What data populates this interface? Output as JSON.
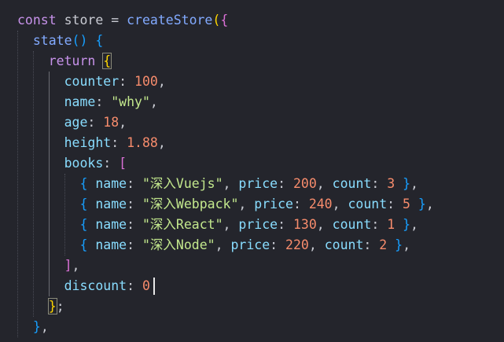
{
  "theme": {
    "background": "#24252c",
    "keyword": "#c792ea",
    "function": "#82aaff",
    "property": "#89ddff",
    "number": "#f78c6c",
    "string": "#c3e88d",
    "punctuation": "#c9cbd3",
    "bracket_outer": "#ffd700",
    "bracket_inner": "#da70d6",
    "bracket_blue": "#179fff"
  },
  "code_lines": [
    [
      {
        "t": "const",
        "c": "keyword"
      },
      {
        "t": " store ",
        "c": "punctuation"
      },
      {
        "t": "=",
        "c": "punctuation"
      },
      {
        "t": " ",
        "c": "punctuation"
      },
      {
        "t": "createStore",
        "c": "function"
      },
      {
        "t": "(",
        "c": "bracket_outer"
      },
      {
        "t": "{",
        "c": "bracket_inner"
      }
    ],
    [
      {
        "t": "  ",
        "c": "punctuation"
      },
      {
        "t": "state",
        "c": "function"
      },
      {
        "t": "()",
        "c": "bracket_blue"
      },
      {
        "t": " ",
        "c": "punctuation"
      },
      {
        "t": "{",
        "c": "bracket_blue"
      }
    ],
    [
      {
        "t": "    ",
        "c": "punctuation"
      },
      {
        "t": "return",
        "c": "keyword"
      },
      {
        "t": " ",
        "c": "punctuation"
      },
      {
        "t": "{",
        "c": "bracket_outer",
        "match": true
      }
    ],
    [
      {
        "t": "      ",
        "c": "punctuation"
      },
      {
        "t": "counter",
        "c": "property"
      },
      {
        "t": ": ",
        "c": "punctuation"
      },
      {
        "t": "100",
        "c": "number"
      },
      {
        "t": ",",
        "c": "punctuation"
      }
    ],
    [
      {
        "t": "      ",
        "c": "punctuation"
      },
      {
        "t": "name",
        "c": "property"
      },
      {
        "t": ": ",
        "c": "punctuation"
      },
      {
        "t": "\"why\"",
        "c": "string"
      },
      {
        "t": ",",
        "c": "punctuation"
      }
    ],
    [
      {
        "t": "      ",
        "c": "punctuation"
      },
      {
        "t": "age",
        "c": "property"
      },
      {
        "t": ": ",
        "c": "punctuation"
      },
      {
        "t": "18",
        "c": "number"
      },
      {
        "t": ",",
        "c": "punctuation"
      }
    ],
    [
      {
        "t": "      ",
        "c": "punctuation"
      },
      {
        "t": "height",
        "c": "property"
      },
      {
        "t": ": ",
        "c": "punctuation"
      },
      {
        "t": "1.88",
        "c": "number"
      },
      {
        "t": ",",
        "c": "punctuation"
      }
    ],
    [
      {
        "t": "      ",
        "c": "punctuation"
      },
      {
        "t": "books",
        "c": "property"
      },
      {
        "t": ": ",
        "c": "punctuation"
      },
      {
        "t": "[",
        "c": "bracket_inner"
      }
    ],
    [
      {
        "t": "        ",
        "c": "punctuation"
      },
      {
        "t": "{",
        "c": "bracket_blue"
      },
      {
        "t": " ",
        "c": "punctuation"
      },
      {
        "t": "name",
        "c": "property"
      },
      {
        "t": ": ",
        "c": "punctuation"
      },
      {
        "t": "\"深入Vuejs\"",
        "c": "string"
      },
      {
        "t": ", ",
        "c": "punctuation"
      },
      {
        "t": "price",
        "c": "property"
      },
      {
        "t": ": ",
        "c": "punctuation"
      },
      {
        "t": "200",
        "c": "number"
      },
      {
        "t": ", ",
        "c": "punctuation"
      },
      {
        "t": "count",
        "c": "property"
      },
      {
        "t": ": ",
        "c": "punctuation"
      },
      {
        "t": "3",
        "c": "number"
      },
      {
        "t": " ",
        "c": "punctuation"
      },
      {
        "t": "}",
        "c": "bracket_blue"
      },
      {
        "t": ",",
        "c": "punctuation"
      }
    ],
    [
      {
        "t": "        ",
        "c": "punctuation"
      },
      {
        "t": "{",
        "c": "bracket_blue"
      },
      {
        "t": " ",
        "c": "punctuation"
      },
      {
        "t": "name",
        "c": "property"
      },
      {
        "t": ": ",
        "c": "punctuation"
      },
      {
        "t": "\"深入Webpack\"",
        "c": "string"
      },
      {
        "t": ", ",
        "c": "punctuation"
      },
      {
        "t": "price",
        "c": "property"
      },
      {
        "t": ": ",
        "c": "punctuation"
      },
      {
        "t": "240",
        "c": "number"
      },
      {
        "t": ", ",
        "c": "punctuation"
      },
      {
        "t": "count",
        "c": "property"
      },
      {
        "t": ": ",
        "c": "punctuation"
      },
      {
        "t": "5",
        "c": "number"
      },
      {
        "t": " ",
        "c": "punctuation"
      },
      {
        "t": "}",
        "c": "bracket_blue"
      },
      {
        "t": ",",
        "c": "punctuation"
      }
    ],
    [
      {
        "t": "        ",
        "c": "punctuation"
      },
      {
        "t": "{",
        "c": "bracket_blue"
      },
      {
        "t": " ",
        "c": "punctuation"
      },
      {
        "t": "name",
        "c": "property"
      },
      {
        "t": ": ",
        "c": "punctuation"
      },
      {
        "t": "\"深入React\"",
        "c": "string"
      },
      {
        "t": ", ",
        "c": "punctuation"
      },
      {
        "t": "price",
        "c": "property"
      },
      {
        "t": ": ",
        "c": "punctuation"
      },
      {
        "t": "130",
        "c": "number"
      },
      {
        "t": ", ",
        "c": "punctuation"
      },
      {
        "t": "count",
        "c": "property"
      },
      {
        "t": ": ",
        "c": "punctuation"
      },
      {
        "t": "1",
        "c": "number"
      },
      {
        "t": " ",
        "c": "punctuation"
      },
      {
        "t": "}",
        "c": "bracket_blue"
      },
      {
        "t": ",",
        "c": "punctuation"
      }
    ],
    [
      {
        "t": "        ",
        "c": "punctuation"
      },
      {
        "t": "{",
        "c": "bracket_blue"
      },
      {
        "t": " ",
        "c": "punctuation"
      },
      {
        "t": "name",
        "c": "property"
      },
      {
        "t": ": ",
        "c": "punctuation"
      },
      {
        "t": "\"深入Node\"",
        "c": "string"
      },
      {
        "t": ", ",
        "c": "punctuation"
      },
      {
        "t": "price",
        "c": "property"
      },
      {
        "t": ": ",
        "c": "punctuation"
      },
      {
        "t": "220",
        "c": "number"
      },
      {
        "t": ", ",
        "c": "punctuation"
      },
      {
        "t": "count",
        "c": "property"
      },
      {
        "t": ": ",
        "c": "punctuation"
      },
      {
        "t": "2",
        "c": "number"
      },
      {
        "t": " ",
        "c": "punctuation"
      },
      {
        "t": "}",
        "c": "bracket_blue"
      },
      {
        "t": ",",
        "c": "punctuation"
      }
    ],
    [
      {
        "t": "      ",
        "c": "punctuation"
      },
      {
        "t": "]",
        "c": "bracket_inner"
      },
      {
        "t": ",",
        "c": "punctuation"
      }
    ],
    [
      {
        "t": "      ",
        "c": "punctuation"
      },
      {
        "t": "discount",
        "c": "property"
      },
      {
        "t": ": ",
        "c": "punctuation"
      },
      {
        "t": "0",
        "c": "number"
      }
    ],
    [
      {
        "t": "    ",
        "c": "punctuation"
      },
      {
        "t": "}",
        "c": "bracket_outer",
        "match": true
      },
      {
        "t": ";",
        "c": "punctuation"
      }
    ],
    [
      {
        "t": "  ",
        "c": "punctuation"
      },
      {
        "t": "}",
        "c": "bracket_blue"
      },
      {
        "t": ",",
        "c": "punctuation"
      }
    ]
  ]
}
